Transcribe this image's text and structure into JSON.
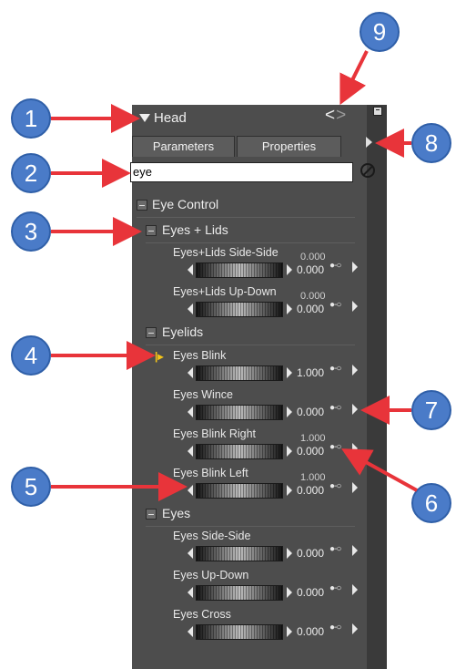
{
  "panel": {
    "title": "Head",
    "nav_prev": "<",
    "nav_next": ">",
    "tabs": [
      {
        "label": "Parameters"
      },
      {
        "label": "Properties"
      }
    ],
    "search": {
      "value": "eye"
    }
  },
  "groups": {
    "eye_control": "Eye Control",
    "eyes_lids": "Eyes + Lids",
    "eyelids": "Eyelids",
    "eyes": "Eyes"
  },
  "params": [
    {
      "label": "Eyes+Lids Side-Side",
      "value": "0.000",
      "top_value": "0.000"
    },
    {
      "label": "Eyes+Lids Up-Down",
      "value": "0.000",
      "top_value": "0.000"
    },
    {
      "label": "Eyes Blink",
      "value": "1.000",
      "top_value": ""
    },
    {
      "label": "Eyes Wince",
      "value": "0.000",
      "top_value": ""
    },
    {
      "label": "Eyes Blink Right",
      "value": "0.000",
      "top_value": "1.000"
    },
    {
      "label": "Eyes Blink Left",
      "value": "0.000",
      "top_value": "1.000"
    },
    {
      "label": "Eyes Side-Side",
      "value": "0.000",
      "top_value": ""
    },
    {
      "label": "Eyes Up-Down",
      "value": "0.000",
      "top_value": ""
    },
    {
      "label": "Eyes Cross",
      "value": "0.000",
      "top_value": ""
    }
  ],
  "callouts": [
    "1",
    "2",
    "3",
    "4",
    "5",
    "6",
    "7",
    "8",
    "9"
  ],
  "colors": {
    "panel_bg": "#4d4d4d",
    "callout_fill": "#4a7bc8",
    "arrow": "#e8343a",
    "yellow_marker": "#f5c518"
  },
  "icons": {
    "collapse": "triangle-down-icon",
    "clear_search": "clear-icon",
    "key": "keyframe-key-icon",
    "menu": "menu-arrow-icon"
  }
}
